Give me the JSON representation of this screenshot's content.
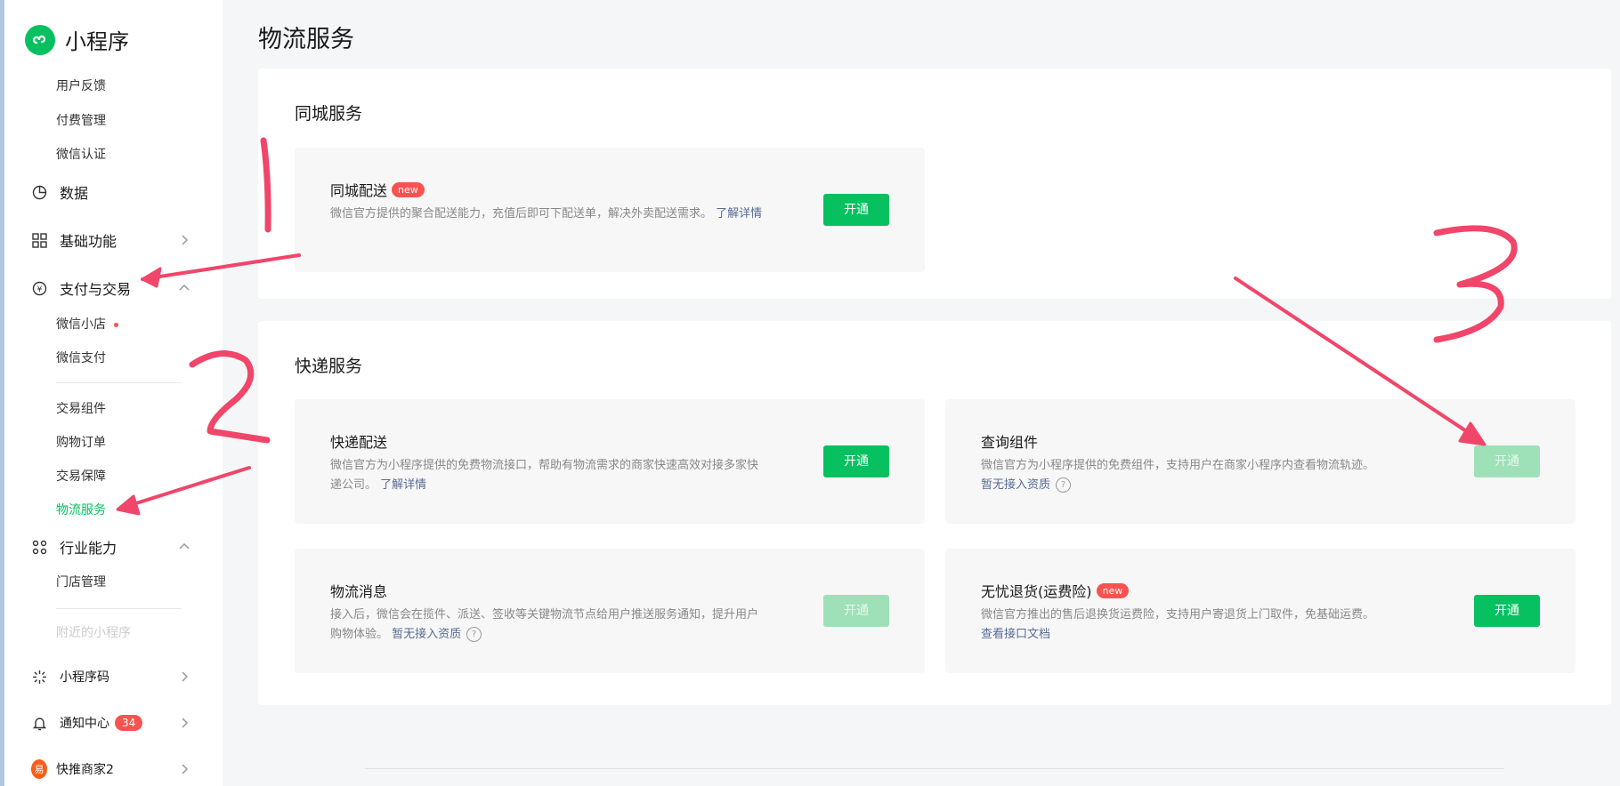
{
  "sidebar": {
    "brand": "小程序",
    "items_top": [
      "用户反馈",
      "付费管理",
      "微信认证"
    ],
    "data_label": "数据",
    "basic_label": "基础功能",
    "pay_label": "支付与交易",
    "pay_sub_1": [
      "微信小店",
      "微信支付"
    ],
    "pay_sub_2": [
      "交易组件",
      "购物订单",
      "交易保障",
      "物流服务"
    ],
    "industry_label": "行业能力",
    "industry_sub": [
      "门店管理",
      "附近的小程序"
    ],
    "qrcode_label": "小程序码",
    "notice_label": "通知中心",
    "notice_count": "34",
    "merchant_label": "快推商家2",
    "merchant_avatar": "易"
  },
  "page": {
    "title": "物流服务"
  },
  "city_panel": {
    "title": "同城服务",
    "card": {
      "title": "同城配送",
      "tag": "new",
      "desc": "微信官方提供的聚合配送能力，充值后即可下配送单，解决外卖配送需求。",
      "link": "了解详情",
      "button": "开通"
    }
  },
  "express_panel": {
    "title": "快递服务",
    "cards": [
      {
        "title": "快递配送",
        "desc": "微信官方为小程序提供的免费物流接口，帮助有物流需求的商家快速高效对接多家快递公司。",
        "link": "了解详情",
        "button": "开通"
      },
      {
        "title": "查询组件",
        "desc": "微信官方为小程序提供的免费组件，支持用户在商家小程序内查看物流轨迹。",
        "link": "暂无接入资质",
        "button": "开通"
      },
      {
        "title": "物流消息",
        "desc": "接入后，微信会在揽件、派送、签收等关键物流节点给用户推送服务通知，提升用户购物体验。",
        "link": "暂无接入资质",
        "button": "开通"
      },
      {
        "title": "无忧退货(运费险)",
        "tag": "new",
        "desc": "微信官方推出的售后退换货运费险，支持用户寄退货上门取件，免基础运费。",
        "link": "查看接口文档",
        "button": "开通"
      }
    ]
  },
  "colors": {
    "brand_green": "#07c160",
    "disabled_green": "#9ee0b8",
    "badge_red": "#fa5151",
    "link_blue": "#576b95",
    "annotation_pink": "#f0466a"
  },
  "annotations": [
    "1",
    "2",
    "3"
  ]
}
